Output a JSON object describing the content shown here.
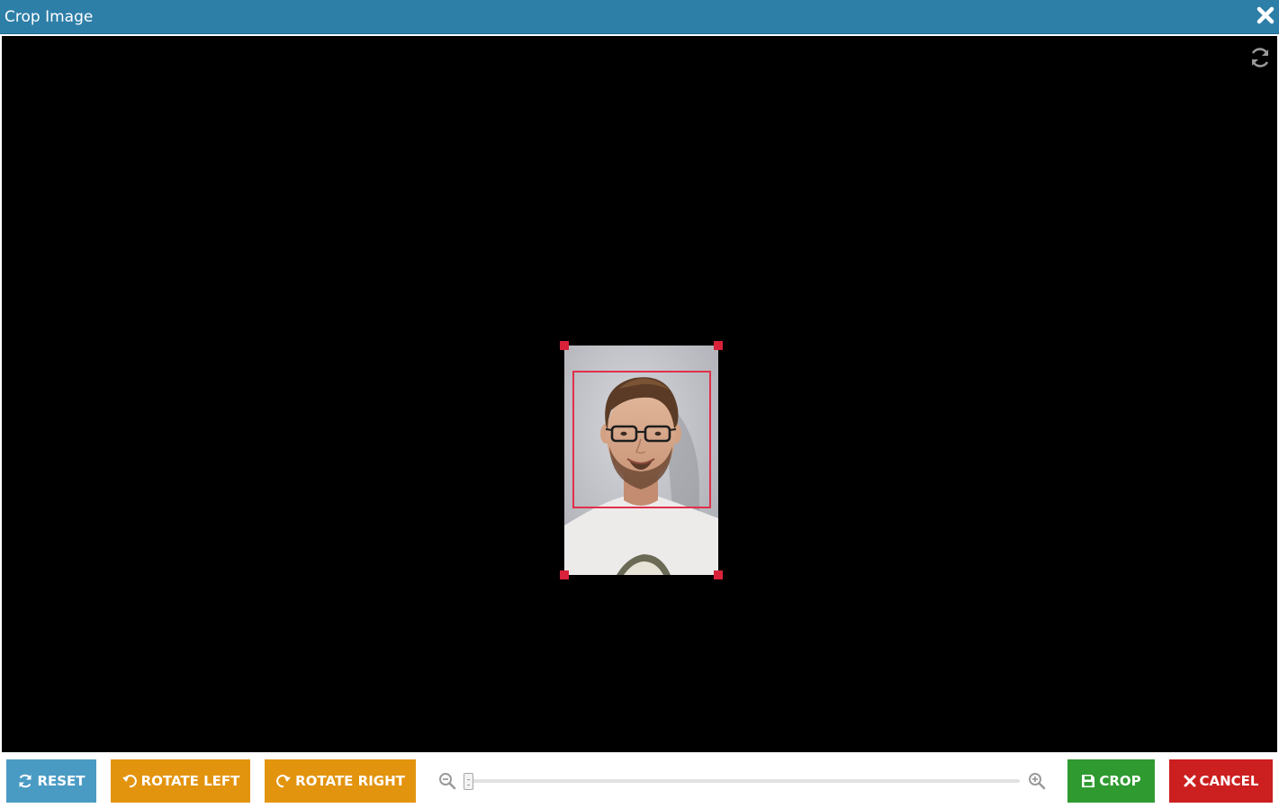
{
  "dialog": {
    "title": "Crop Image",
    "close_icon": "close-icon"
  },
  "canvas": {
    "refresh_icon": "refresh-icon",
    "image": {
      "subject": "portrait photo",
      "handles": [
        "top-left",
        "top-right",
        "bottom-left",
        "bottom-right"
      ]
    }
  },
  "toolbar": {
    "reset_label": "RESET",
    "rotate_left_label": "ROTATE LEFT",
    "rotate_right_label": "ROTATE RIGHT",
    "crop_label": "CROP",
    "cancel_label": "CANCEL",
    "zoom": {
      "value": 0.0,
      "min_icon": "zoom-out-icon",
      "max_icon": "zoom-in-icon"
    }
  },
  "colors": {
    "titlebar": "#2e7fa8",
    "reset": "#4a9bc4",
    "rotate": "#e3940f",
    "crop": "#2f9a2f",
    "cancel": "#cc1f1f",
    "handle": "#d9223a"
  }
}
